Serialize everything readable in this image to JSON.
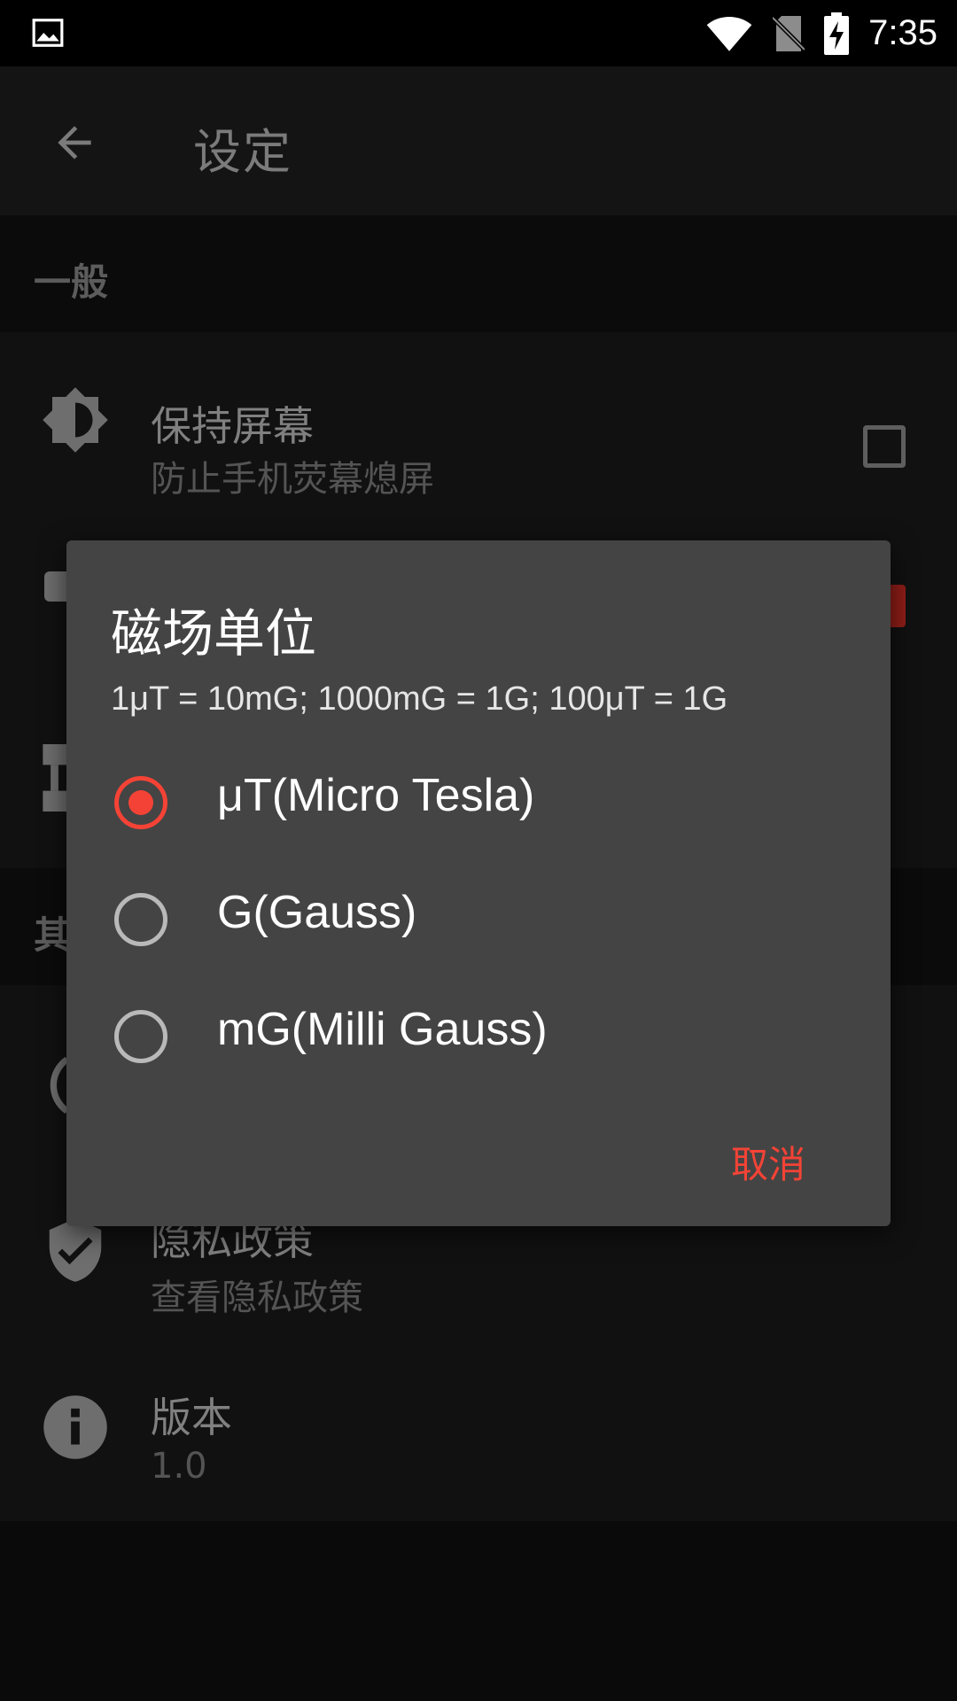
{
  "status_bar": {
    "time": "7:35",
    "icons": [
      "image-icon",
      "wifi-icon",
      "no-sim-icon",
      "battery-charging-icon"
    ]
  },
  "app_bar": {
    "title": "设定",
    "back_icon": "arrow-left-icon"
  },
  "sections": {
    "general": {
      "label": "一般",
      "items": [
        {
          "icon": "brightness-icon",
          "title": "保持屏幕",
          "subtitle": "防止手机荧幕熄屏",
          "checked": false
        }
      ]
    },
    "other": {
      "label": "其",
      "items": [
        {
          "icon": "shield-check-icon",
          "title": "隐私政策",
          "subtitle": "查看隐私政策"
        },
        {
          "icon": "info-icon",
          "title": "版本",
          "subtitle": "1.0"
        }
      ]
    }
  },
  "dialog": {
    "title": "磁场单位",
    "message": "1μT = 10mG; 1000mG = 1G; 100μT = 1G",
    "options": [
      {
        "label": "μT(Micro Tesla)",
        "selected": true
      },
      {
        "label": "G(Gauss)",
        "selected": false
      },
      {
        "label": "mG(Milli Gauss)",
        "selected": false
      }
    ],
    "cancel_label": "取消"
  },
  "colors": {
    "accent": "#f44336",
    "dialog_bg": "#444444",
    "status_bar_bg": "#000000"
  }
}
